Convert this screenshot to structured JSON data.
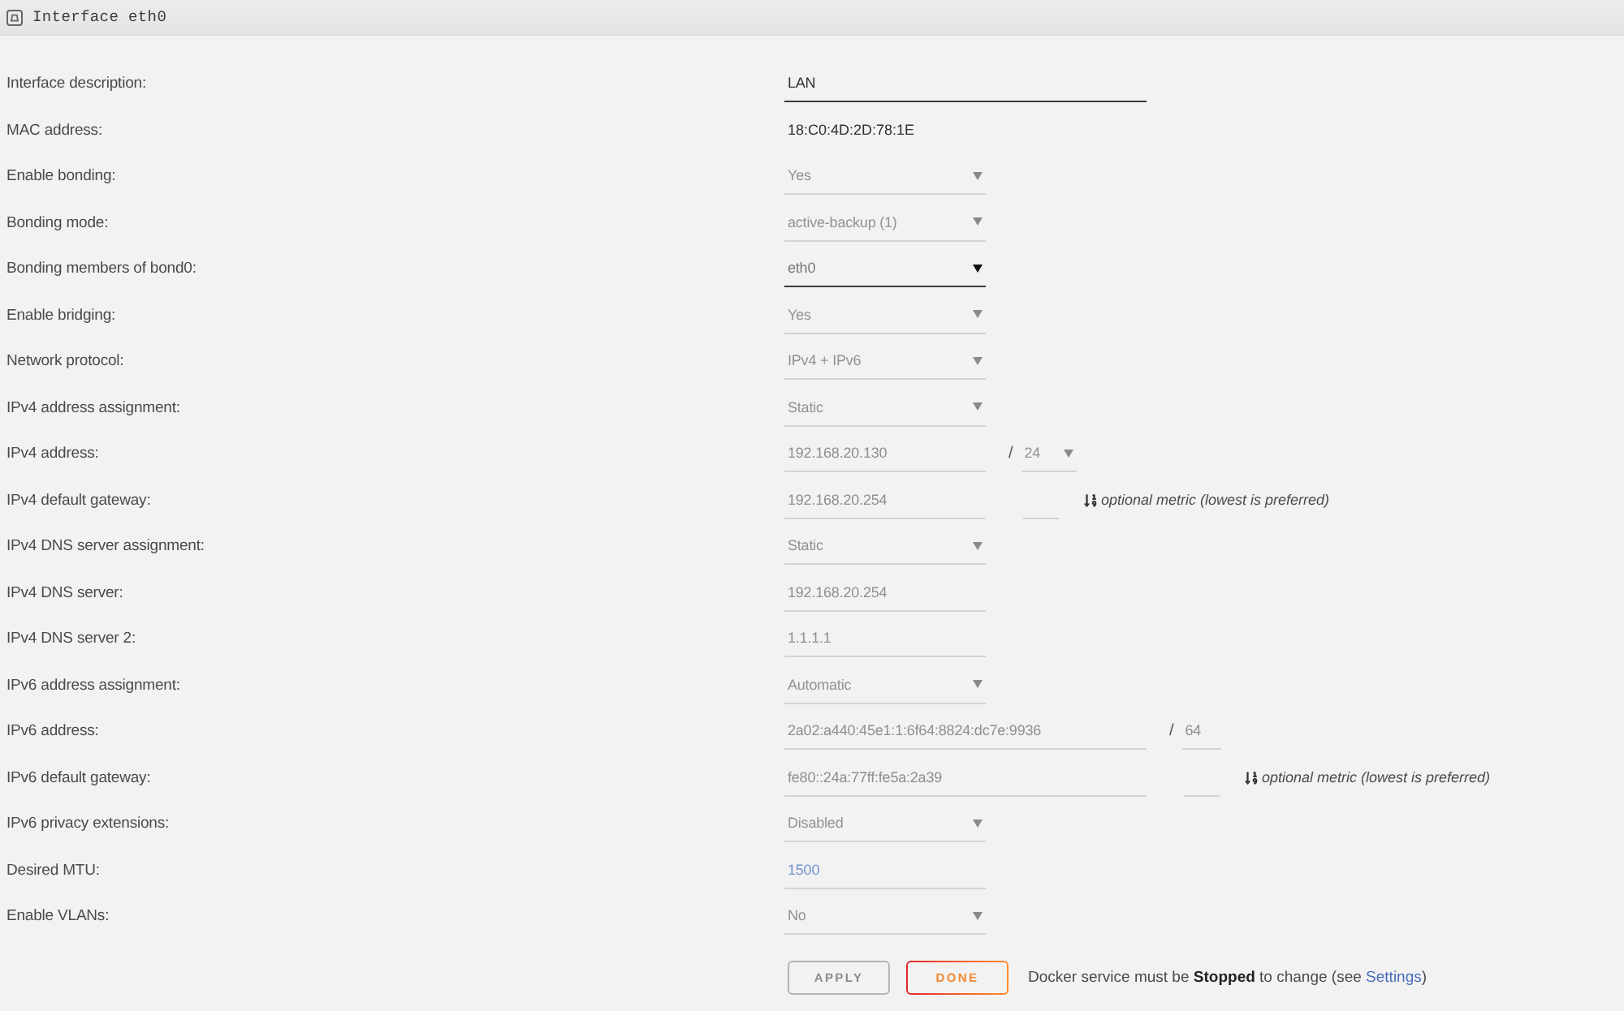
{
  "header": {
    "title": "Interface eth0"
  },
  "rows": [
    {
      "label": "Interface description:",
      "kind": "text",
      "value": "LAN",
      "disabled": false
    },
    {
      "label": "MAC address:",
      "kind": "static",
      "value": "18:C0:4D:2D:78:1E"
    },
    {
      "label": "Enable bonding:",
      "kind": "select",
      "value": "Yes",
      "disabled": true
    },
    {
      "label": "Bonding mode:",
      "kind": "select",
      "value": "active-backup (1)",
      "disabled": true
    },
    {
      "label": "Bonding members of bond0:",
      "kind": "select",
      "value": "eth0",
      "disabled": false
    },
    {
      "label": "Enable bridging:",
      "kind": "select",
      "value": "Yes",
      "disabled": true
    },
    {
      "label": "Network protocol:",
      "kind": "select",
      "value": "IPv4 + IPv6",
      "disabled": true
    },
    {
      "label": "IPv4 address assignment:",
      "kind": "select",
      "value": "Static",
      "disabled": true
    },
    {
      "label": "IPv4 address:",
      "kind": "ip",
      "value": "192.168.20.130",
      "disabled": true,
      "separator": "/",
      "prefix": {
        "kind": "select",
        "value": "24",
        "disabled": true
      }
    },
    {
      "label": "IPv4 default gateway:",
      "kind": "ip",
      "value": "192.168.20.254",
      "disabled": true,
      "metric": {
        "disabled": true,
        "hint": "optional metric (lowest is preferred)"
      }
    },
    {
      "label": "IPv4 DNS server assignment:",
      "kind": "select",
      "value": "Static",
      "disabled": true
    },
    {
      "label": "IPv4 DNS server:",
      "kind": "ip",
      "value": "192.168.20.254",
      "disabled": true
    },
    {
      "label": "IPv4 DNS server 2:",
      "kind": "ip",
      "value": "1.1.1.1",
      "disabled": true
    },
    {
      "label": "IPv6 address assignment:",
      "kind": "select",
      "value": "Automatic",
      "disabled": true
    },
    {
      "label": "IPv6 address:",
      "kind": "ip",
      "value": "2a02:a440:45e1:1:6f64:8824:dc7e:9936",
      "disabled": true,
      "separator": "/",
      "prefix": {
        "kind": "ip",
        "value": "64",
        "disabled": true
      }
    },
    {
      "label": "IPv6 default gateway:",
      "kind": "ip",
      "value": "fe80::24a:77ff:fe5a:2a39",
      "disabled": true,
      "metric": {
        "disabled": true,
        "hint": "optional metric (lowest is preferred)"
      }
    },
    {
      "label": "IPv6 privacy extensions:",
      "kind": "select",
      "value": "Disabled",
      "disabled": true
    },
    {
      "label": "Desired MTU:",
      "kind": "number",
      "placeholder": "1500",
      "disabled": true
    },
    {
      "label": "Enable VLANs:",
      "kind": "select",
      "value": "No",
      "disabled": true
    }
  ],
  "buttons": [
    {
      "label": "APPLY",
      "disabled": true
    },
    {
      "label": "DONE",
      "disabled": false
    }
  ],
  "notice": {
    "text": "Docker service must be **Stopped** to change (see ",
    "link": "Settings",
    "text_after": ")"
  }
}
